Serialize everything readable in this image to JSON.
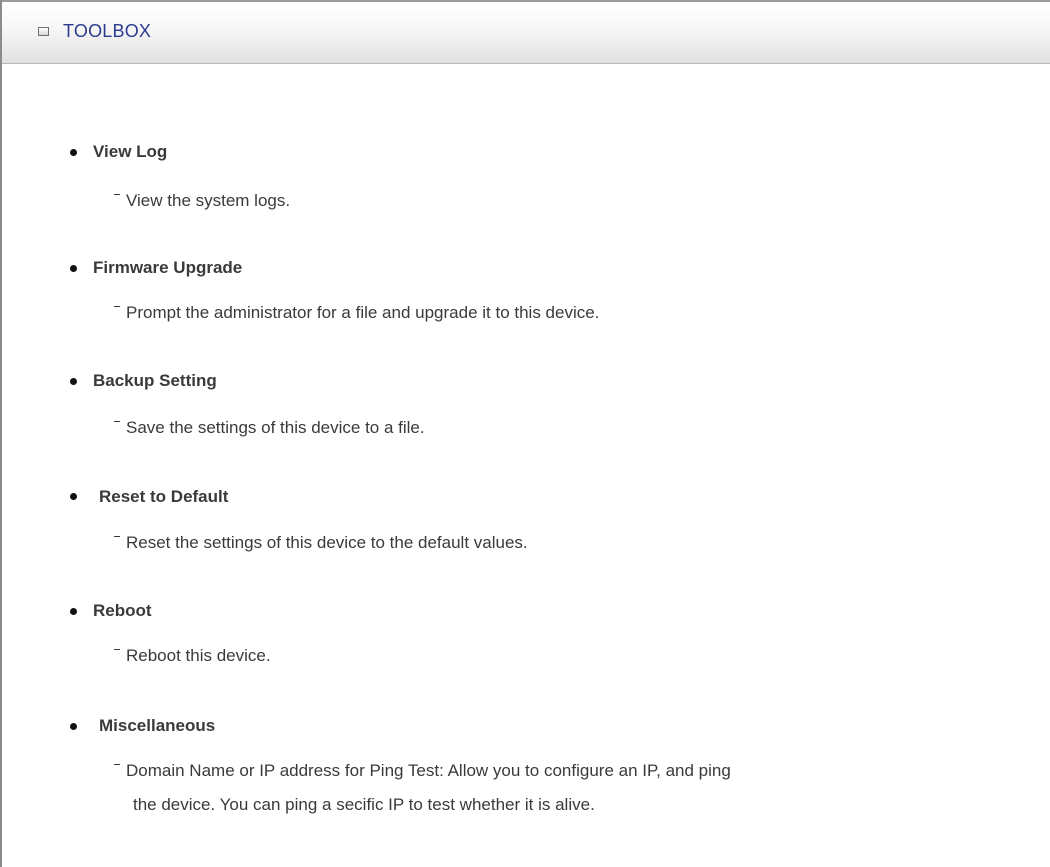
{
  "header": {
    "title": "TOOLBOX"
  },
  "items": [
    {
      "title": "View Log",
      "description": "View the system logs."
    },
    {
      "title": "Firmware Upgrade",
      "description": "Prompt the administrator for a file and upgrade it to this device."
    },
    {
      "title": "Backup Setting",
      "description": "Save the settings of this device to a file."
    },
    {
      "title": "Reset to Default",
      "description": "Reset the settings of this device to the default values."
    },
    {
      "title": "Reboot",
      "description": "Reboot this device."
    },
    {
      "title": "Miscellaneous",
      "description": "Domain Name or IP address for Ping Test: Allow you to configure an IP, and ping",
      "description_line2": "the device. You can ping a secific IP to test whether it is alive."
    }
  ],
  "colors": {
    "header_title": "#2c3b8f",
    "body_text": "#3a3a3a"
  },
  "icons": {
    "header": "window-square-icon",
    "bullet": "bullet-dot-icon"
  }
}
